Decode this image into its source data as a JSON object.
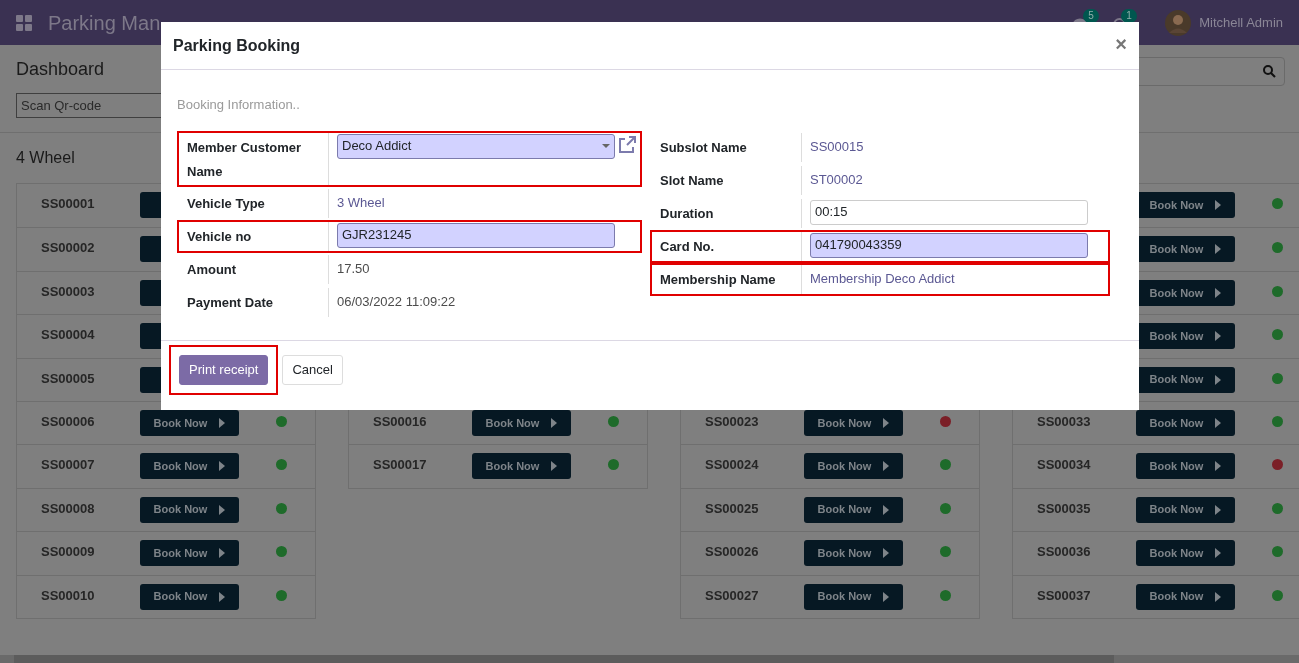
{
  "navbar": {
    "app_title": "Parking Man",
    "chat_count": "5",
    "activity_count": "1",
    "user": "Mitchell Admin"
  },
  "page": {
    "title": "Dashboard",
    "search_placeholder": "Scan Qr-code",
    "section": "4 Wheel"
  },
  "columns": [
    {
      "rows": [
        {
          "name": "SS00001"
        },
        {
          "name": "SS00002"
        },
        {
          "name": "SS00003"
        },
        {
          "name": "SS00004"
        },
        {
          "name": "SS00005"
        },
        {
          "name": "SS00006",
          "button": "Book Now",
          "color": "#1e6b2a"
        },
        {
          "name": "SS00007",
          "button": "Book Now",
          "color": "#1e6b2a"
        },
        {
          "name": "SS00008",
          "button": "Book Now",
          "color": "#1e6b2a"
        },
        {
          "name": "SS00009",
          "button": "Book Now",
          "color": "#1e6b2a"
        },
        {
          "name": "SS00010",
          "button": "Book Now",
          "color": "#1e6b2a"
        }
      ]
    },
    {
      "rows": [
        {},
        {},
        {},
        {},
        {},
        {
          "name": "SS00016",
          "button": "Book Now",
          "color": "#1e6b2a"
        },
        {
          "name": "SS00017",
          "button": "Book Now",
          "color": "#1e6b2a"
        }
      ]
    },
    {
      "rows": [
        {},
        {},
        {},
        {},
        {},
        {
          "name": "SS00023",
          "button": "Book Now",
          "color": "#7b1f27"
        },
        {
          "name": "SS00024",
          "button": "Book Now",
          "color": "#1e6b2a"
        },
        {
          "name": "SS00025",
          "button": "Book Now",
          "color": "#1e6b2a"
        },
        {
          "name": "SS00026",
          "button": "Book Now",
          "color": "#1e6b2a"
        },
        {
          "name": "SS00027",
          "button": "Book Now",
          "color": "#1e6b2a"
        }
      ]
    },
    {
      "rows": [
        {
          "button": "Book Now",
          "color": "#1e6b2a"
        },
        {
          "button": "Book Now",
          "color": "#1e6b2a"
        },
        {
          "button": "Book Now",
          "color": "#1e6b2a"
        },
        {
          "button": "Book Now",
          "color": "#1e6b2a"
        },
        {
          "button": "Book Now",
          "color": "#1e6b2a"
        },
        {
          "name": "SS00033",
          "button": "Book Now",
          "color": "#1e6b2a"
        },
        {
          "name": "SS00034",
          "button": "Book Now",
          "color": "#7b1f27"
        },
        {
          "name": "SS00035",
          "button": "Book Now",
          "color": "#1e6b2a"
        },
        {
          "name": "SS00036",
          "button": "Book Now",
          "color": "#1e6b2a"
        },
        {
          "name": "SS00037",
          "button": "Book Now",
          "color": "#1e6b2a"
        }
      ]
    }
  ],
  "dialog": {
    "title": "Parking Booking",
    "close": "×",
    "subtitle": "Booking Information..",
    "left_fields": [
      {
        "label": "Member Customer Name",
        "kind": "select",
        "value": "Deco Addict",
        "required": true,
        "highlighted": true
      },
      {
        "label": "Vehicle Type",
        "kind": "link",
        "value": "3 Wheel",
        "highlighted": false
      },
      {
        "label": "Vehicle no",
        "kind": "input",
        "value": "GJR231245",
        "required": true,
        "highlighted": true
      },
      {
        "label": "Amount",
        "kind": "text",
        "value": "17.50",
        "highlighted": false
      },
      {
        "label": "Payment Date",
        "kind": "text",
        "value": "06/03/2022 11:09:22",
        "highlighted": false
      }
    ],
    "right_fields": [
      {
        "label": "Subslot Name",
        "kind": "link",
        "value": "SS00015",
        "highlighted": false
      },
      {
        "label": "Slot Name",
        "kind": "link",
        "value": "ST00002",
        "highlighted": false
      },
      {
        "label": "Duration",
        "kind": "input",
        "value": "00:15",
        "required": false,
        "highlighted": false
      },
      {
        "label": "Card No.",
        "kind": "input",
        "value": "041790043359",
        "required": true,
        "highlighted": true
      },
      {
        "label": "Membership Name",
        "kind": "link",
        "value": "Membership Deco Addict",
        "highlighted": true
      }
    ],
    "buttons": [
      {
        "label": "Print receipt",
        "kind": "primary",
        "highlighted": true
      },
      {
        "label": "Cancel",
        "kind": "secondary",
        "highlighted": false
      }
    ]
  }
}
